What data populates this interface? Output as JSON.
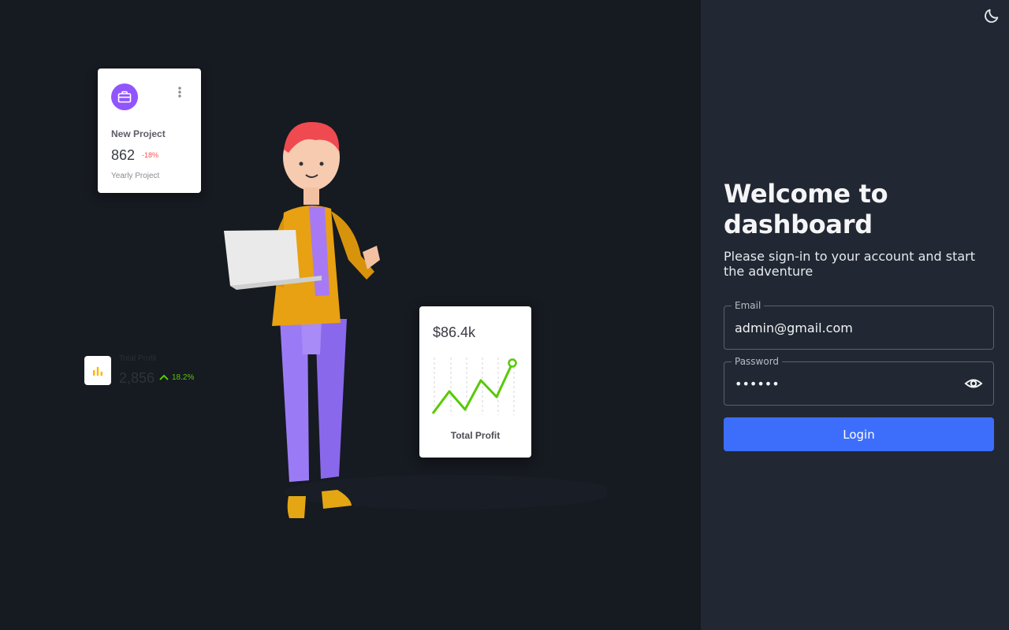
{
  "app": {
    "theme_toggle_icon": "moon-icon"
  },
  "illustration": {
    "project_card": {
      "icon": "briefcase-icon",
      "menu_icon": "more-vertical-icon",
      "title": "New Project",
      "value": "862",
      "change": "-18%",
      "subtitle": "Yearly Project",
      "accent": "#9155fd",
      "change_color": "#ff4c51"
    },
    "total_profit_mini": {
      "icon": "bar-chart-icon",
      "label": "Total Profit",
      "value": "2,856",
      "change": "18.2%",
      "change_color": "#56ca00"
    },
    "profit_card": {
      "amount": "$86.4k",
      "label": "Total Profit",
      "line_color": "#56ca00"
    },
    "person": "character-with-laptop"
  },
  "login": {
    "title": "Welcome to dashboard",
    "subtitle": "Please sign-in to your account and start the adventure",
    "email": {
      "label": "Email",
      "value": "admin@gmail.com"
    },
    "password": {
      "label": "Password",
      "value": "••••••",
      "toggle_icon": "eye-icon"
    },
    "submit_label": "Login",
    "primary_color": "#3d6dfb"
  }
}
